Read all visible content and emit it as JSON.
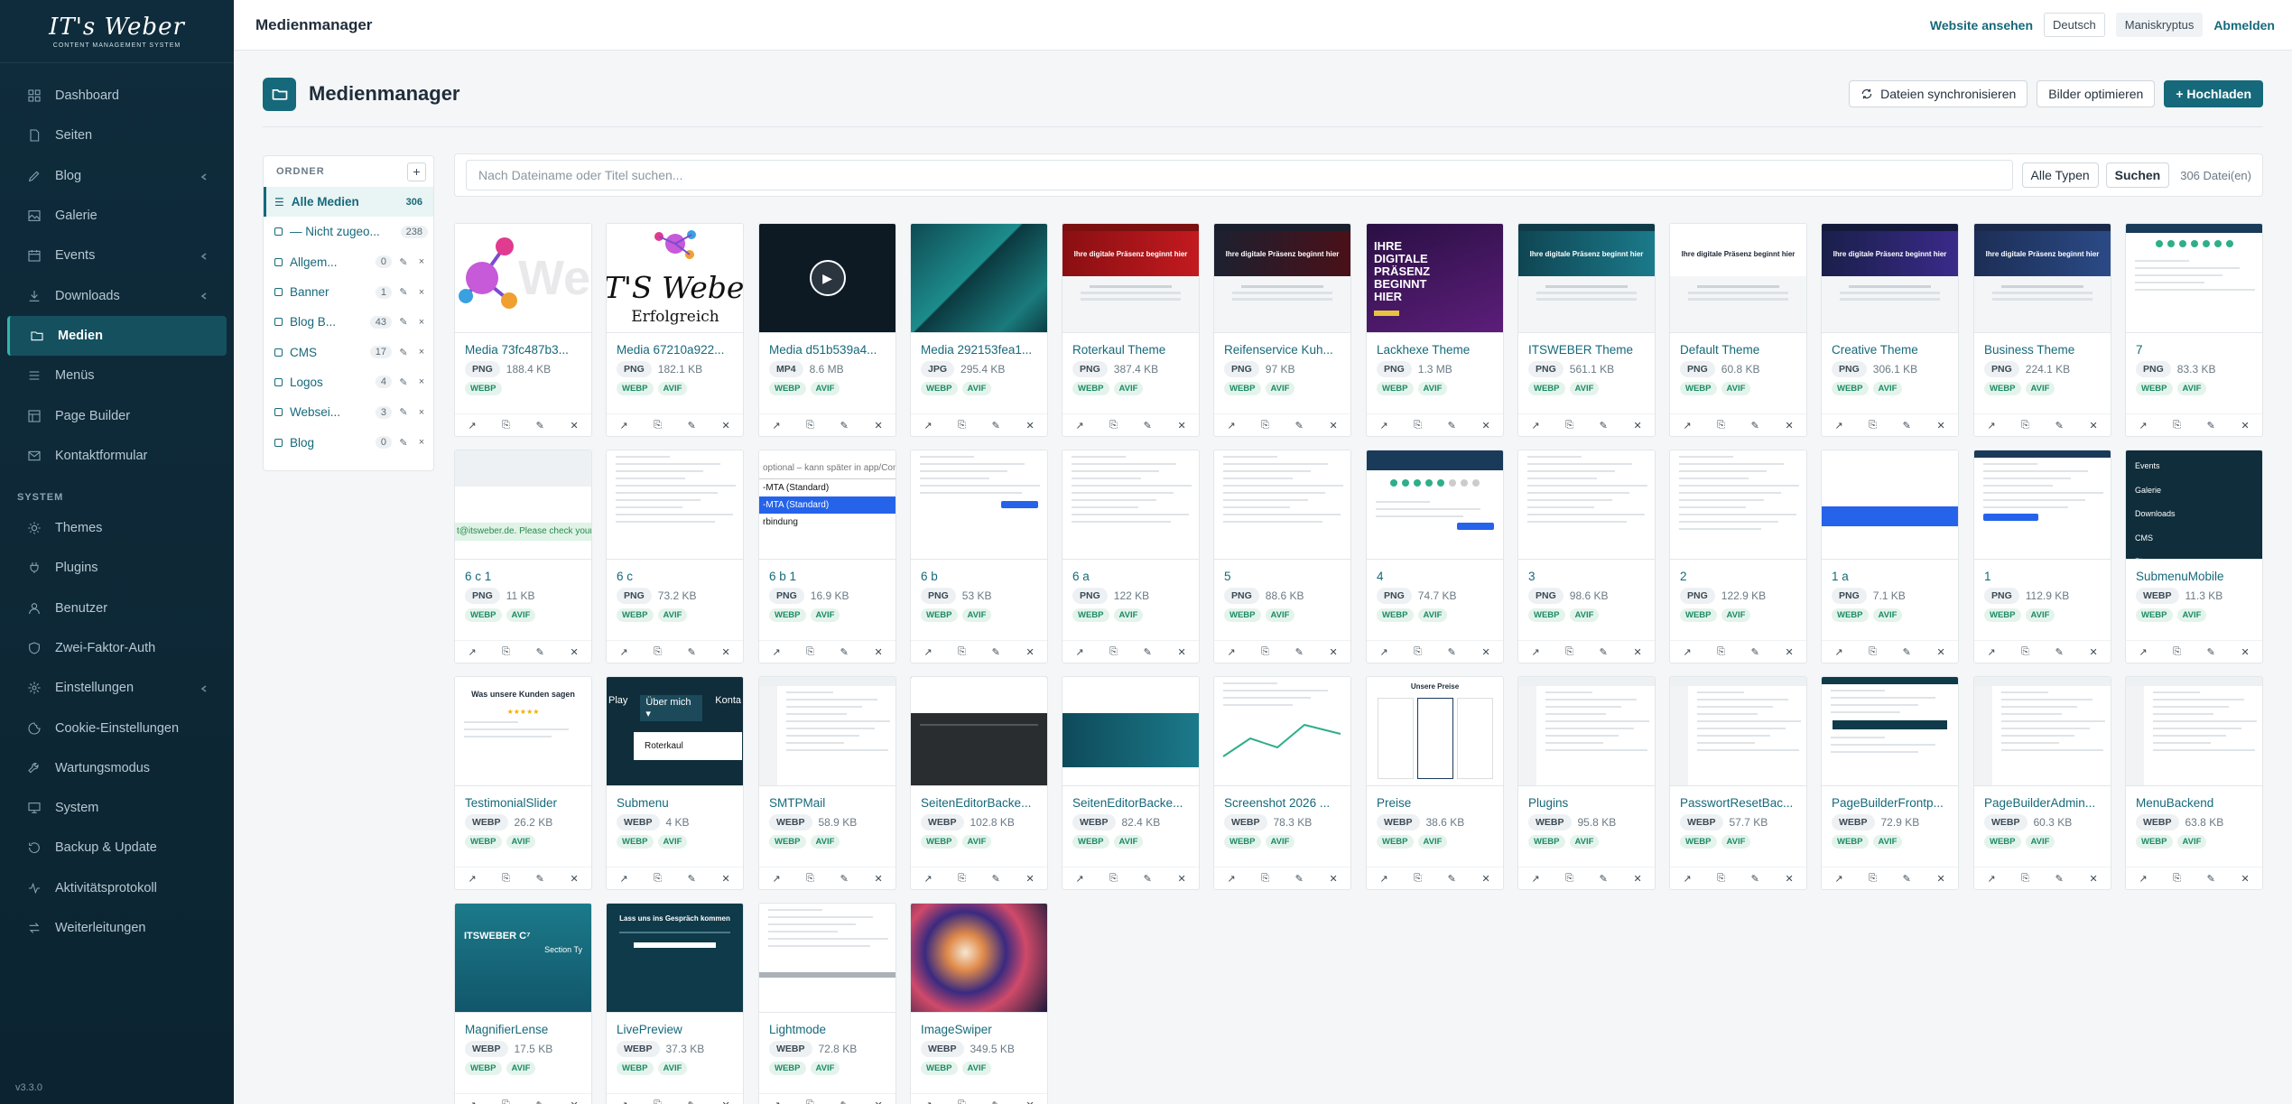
{
  "sidebar": {
    "logo": "IT's Weber",
    "logo_sub": "CONTENT MANAGEMENT SYSTEM",
    "items": [
      {
        "label": "Dashboard",
        "icon": "dashboard-icon"
      },
      {
        "label": "Seiten",
        "icon": "page-icon"
      },
      {
        "label": "Blog",
        "icon": "pen-icon",
        "chevron": true
      },
      {
        "label": "Galerie",
        "icon": "image-icon"
      },
      {
        "label": "Events",
        "icon": "calendar-icon",
        "chevron": true
      },
      {
        "label": "Downloads",
        "icon": "download-icon",
        "chevron": true
      },
      {
        "label": "Medien",
        "icon": "media-icon",
        "active": true
      },
      {
        "label": "Menüs",
        "icon": "menu-icon"
      },
      {
        "label": "Page Builder",
        "icon": "layout-icon"
      },
      {
        "label": "Kontaktformular",
        "icon": "mail-icon"
      }
    ],
    "system_title": "SYSTEM",
    "system_items": [
      {
        "label": "Themes",
        "icon": "sun-icon"
      },
      {
        "label": "Plugins",
        "icon": "plugin-icon"
      },
      {
        "label": "Benutzer",
        "icon": "user-icon"
      },
      {
        "label": "Zwei-Faktor-Auth",
        "icon": "shield-icon"
      },
      {
        "label": "Einstellungen",
        "icon": "gear-icon",
        "chevron": true
      },
      {
        "label": "Cookie-Einstellungen",
        "icon": "cookie-icon"
      },
      {
        "label": "Wartungsmodus",
        "icon": "wrench-icon"
      },
      {
        "label": "System",
        "icon": "monitor-icon"
      },
      {
        "label": "Backup & Update",
        "icon": "backup-icon"
      },
      {
        "label": "Aktivitätsprotokoll",
        "icon": "activity-icon"
      },
      {
        "label": "Weiterleitungen",
        "icon": "redirect-icon"
      }
    ],
    "version": "v3.3.0"
  },
  "topbar": {
    "title": "Medienmanager",
    "website_link": "Website ansehen",
    "language": "Deutsch",
    "user": "Maniskryptus",
    "logout": "Abmelden"
  },
  "page": {
    "title": "Medienmanager",
    "sync_button": "Dateien synchronisieren",
    "optimize_button": "Bilder optimieren",
    "upload_button": "+ Hochladen"
  },
  "folders": {
    "title": "ORDNER",
    "add": "+",
    "items": [
      {
        "name": "Alle Medien",
        "count": "306",
        "active": true
      },
      {
        "name": "— Nicht zugeo...",
        "count": "238"
      },
      {
        "name": "Allgem...",
        "count": "0",
        "actions": true
      },
      {
        "name": "Banner",
        "count": "1",
        "actions": true
      },
      {
        "name": "Blog B...",
        "count": "43",
        "actions": true
      },
      {
        "name": "CMS",
        "count": "17",
        "actions": true
      },
      {
        "name": "Logos",
        "count": "4",
        "actions": true
      },
      {
        "name": "Websei...",
        "count": "3",
        "actions": true
      },
      {
        "name": "Blog",
        "count": "0",
        "actions": true
      }
    ]
  },
  "search": {
    "placeholder": "Nach Dateiname oder Titel suchen...",
    "type_select": "Alle Typen",
    "button": "Suchen",
    "count": "306 Datei(en)"
  },
  "media": [
    {
      "title": "Media 73fc487b3...",
      "type": "PNG",
      "size": "188.4 KB",
      "badges": [
        "WEBP"
      ],
      "thumb": "molecule-logo"
    },
    {
      "title": "Media 67210a922...",
      "type": "PNG",
      "size": "182.1 KB",
      "badges": [
        "WEBP",
        "AVIF"
      ],
      "thumb": "logo-white"
    },
    {
      "title": "Media d51b539a4...",
      "type": "MP4",
      "size": "8.6 MB",
      "badges": [
        "WEBP",
        "AVIF"
      ],
      "thumb": "video"
    },
    {
      "title": "Media 292153fea1...",
      "type": "JPG",
      "size": "295.4 KB",
      "badges": [
        "WEBP",
        "AVIF"
      ],
      "thumb": "teal"
    },
    {
      "title": "Roterkaul Theme",
      "type": "PNG",
      "size": "387.4 KB",
      "badges": [
        "WEBP",
        "AVIF"
      ],
      "thumb": "red-site"
    },
    {
      "title": "Reifenservice Kuh...",
      "type": "PNG",
      "size": "97 KB",
      "badges": [
        "WEBP",
        "AVIF"
      ],
      "thumb": "dark-red-site"
    },
    {
      "title": "Lackhexe Theme",
      "type": "PNG",
      "size": "1.3 MB",
      "badges": [
        "WEBP",
        "AVIF"
      ],
      "thumb": "purple-site"
    },
    {
      "title": "ITSWEBER Theme",
      "type": "PNG",
      "size": "561.1 KB",
      "badges": [
        "WEBP",
        "AVIF"
      ],
      "thumb": "teal-site"
    },
    {
      "title": "Default Theme",
      "type": "PNG",
      "size": "60.8 KB",
      "badges": [
        "WEBP",
        "AVIF"
      ],
      "thumb": "white-site"
    },
    {
      "title": "Creative Theme",
      "type": "PNG",
      "size": "306.1 KB",
      "badges": [
        "WEBP",
        "AVIF"
      ],
      "thumb": "navy-site"
    },
    {
      "title": "Business Theme",
      "type": "PNG",
      "size": "224.1 KB",
      "badges": [
        "WEBP",
        "AVIF"
      ],
      "thumb": "blue-site"
    },
    {
      "title": "7",
      "type": "PNG",
      "size": "83.3 KB",
      "badges": [
        "WEBP",
        "AVIF"
      ],
      "thumb": "installer"
    },
    {
      "title": "6 c 1",
      "type": "PNG",
      "size": "11 KB",
      "badges": [
        "WEBP",
        "AVIF"
      ],
      "thumb": "green-strip"
    },
    {
      "title": "6 c",
      "type": "PNG",
      "size": "73.2 KB",
      "badges": [
        "WEBP",
        "AVIF"
      ],
      "thumb": "form"
    },
    {
      "title": "6 b 1",
      "type": "PNG",
      "size": "16.9 KB",
      "badges": [
        "WEBP",
        "AVIF"
      ],
      "thumb": "dropdown"
    },
    {
      "title": "6 b",
      "type": "PNG",
      "size": "53 KB",
      "badges": [
        "WEBP",
        "AVIF"
      ],
      "thumb": "form2"
    },
    {
      "title": "6 a",
      "type": "PNG",
      "size": "122 KB",
      "badges": [
        "WEBP",
        "AVIF"
      ],
      "thumb": "form"
    },
    {
      "title": "5",
      "type": "PNG",
      "size": "88.6 KB",
      "badges": [
        "WEBP",
        "AVIF"
      ],
      "thumb": "form"
    },
    {
      "title": "4",
      "type": "PNG",
      "size": "74.7 KB",
      "badges": [
        "WEBP",
        "AVIF"
      ],
      "thumb": "steps"
    },
    {
      "title": "3",
      "type": "PNG",
      "size": "98.6 KB",
      "badges": [
        "WEBP",
        "AVIF"
      ],
      "thumb": "form"
    },
    {
      "title": "2",
      "type": "PNG",
      "size": "122.9 KB",
      "badges": [
        "WEBP",
        "AVIF"
      ],
      "thumb": "table"
    },
    {
      "title": "1 a",
      "type": "PNG",
      "size": "7.1 KB",
      "badges": [
        "WEBP",
        "AVIF"
      ],
      "thumb": "blue-bar"
    },
    {
      "title": "1",
      "type": "PNG",
      "size": "112.9 KB",
      "badges": [
        "WEBP",
        "AVIF"
      ],
      "thumb": "lang"
    },
    {
      "title": "SubmenuMobile",
      "type": "WEBP",
      "size": "11.3 KB",
      "badges": [
        "WEBP",
        "AVIF"
      ],
      "thumb": "dark-menu"
    },
    {
      "title": "TestimonialSlider",
      "type": "WEBP",
      "size": "26.2 KB",
      "badges": [
        "WEBP",
        "AVIF"
      ],
      "thumb": "testimonial"
    },
    {
      "title": "Submenu",
      "type": "WEBP",
      "size": "4 KB",
      "badges": [
        "WEBP",
        "AVIF"
      ],
      "thumb": "submenu"
    },
    {
      "title": "SMTPMail",
      "type": "WEBP",
      "size": "58.9 KB",
      "badges": [
        "WEBP",
        "AVIF"
      ],
      "thumb": "admin"
    },
    {
      "title": "SeitenEditorBacke...",
      "type": "WEBP",
      "size": "102.8 KB",
      "badges": [
        "WEBP",
        "AVIF"
      ],
      "thumb": "dark-editor"
    },
    {
      "title": "SeitenEditorBacke...",
      "type": "WEBP",
      "size": "82.4 KB",
      "badges": [
        "WEBP",
        "AVIF"
      ],
      "thumb": "teal-editor"
    },
    {
      "title": "Screenshot 2026 ...",
      "type": "WEBP",
      "size": "78.3 KB",
      "badges": [
        "WEBP",
        "AVIF"
      ],
      "thumb": "chart"
    },
    {
      "title": "Preise",
      "type": "WEBP",
      "size": "38.6 KB",
      "badges": [
        "WEBP",
        "AVIF"
      ],
      "thumb": "pricing"
    },
    {
      "title": "Plugins",
      "type": "WEBP",
      "size": "95.8 KB",
      "badges": [
        "WEBP",
        "AVIF"
      ],
      "thumb": "admin"
    },
    {
      "title": "PasswortResetBac...",
      "type": "WEBP",
      "size": "57.7 KB",
      "badges": [
        "WEBP",
        "AVIF"
      ],
      "thumb": "admin"
    },
    {
      "title": "PageBuilderFrontp...",
      "type": "WEBP",
      "size": "72.9 KB",
      "badges": [
        "WEBP",
        "AVIF"
      ],
      "thumb": "builder"
    },
    {
      "title": "PageBuilderAdmin...",
      "type": "WEBP",
      "size": "60.3 KB",
      "badges": [
        "WEBP",
        "AVIF"
      ],
      "thumb": "admin"
    },
    {
      "title": "MenuBackend",
      "type": "WEBP",
      "size": "63.8 KB",
      "badges": [
        "WEBP",
        "AVIF"
      ],
      "thumb": "admin"
    },
    {
      "title": "MagnifierLense",
      "type": "WEBP",
      "size": "17.5 KB",
      "badges": [
        "WEBP",
        "AVIF"
      ],
      "thumb": "magnifier"
    },
    {
      "title": "LivePreview",
      "type": "WEBP",
      "size": "37.3 KB",
      "badges": [
        "WEBP",
        "AVIF"
      ],
      "thumb": "preview"
    },
    {
      "title": "Lightmode",
      "type": "WEBP",
      "size": "72.8 KB",
      "badges": [
        "WEBP",
        "AVIF"
      ],
      "thumb": "lightmode"
    },
    {
      "title": "ImageSwiper",
      "type": "WEBP",
      "size": "349.5 KB",
      "badges": [
        "WEBP",
        "AVIF"
      ],
      "thumb": "art"
    }
  ],
  "thumb_text": {
    "logo": "IT'S Weber",
    "logo_tag": "Erfolgreich",
    "site_heading": "Ihre digitale Präsenz beginnt hier",
    "purple_heading": "IHRE DIGITALE PRÄSENZ BEGINNT HIER",
    "green_strip": "t@itsweber.de. Please check your in",
    "dropdown_hint": "optional – kann später in app/Confi",
    "dropdown_a": "-MTA (Standard)",
    "dropdown_b": "-MTA (Standard)",
    "dropdown_c": "rbindung",
    "dark_menu": [
      "Events",
      "Galerie",
      "Downloads",
      "CMS",
      "Play"
    ],
    "testimonial": "Was unsere Kunden sagen",
    "submenu_play": "Play",
    "submenu_parent": "Über mich ▾",
    "submenu_next": "Konta",
    "submenu_item": "Roterkaul",
    "pricing": "Unsere Preise",
    "magnifier_brand": "ITSWEBER C⁷",
    "magnifier_section": "Section Ty",
    "preview": "Lass uns ins Gespräch kommen"
  }
}
